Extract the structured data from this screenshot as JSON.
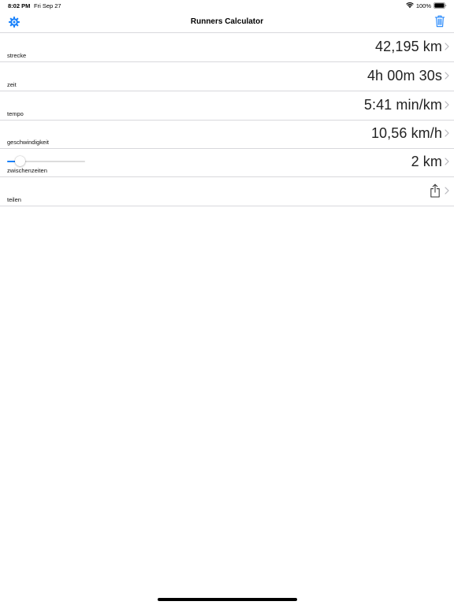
{
  "status_bar": {
    "time": "8:02 PM",
    "date": "Fri Sep 27",
    "battery": "100%",
    "icons": [
      "wifi-icon",
      "battery-icon"
    ]
  },
  "nav": {
    "title": "Runners Calculator",
    "left_icon": "gear-icon",
    "right_icon": "trash-icon"
  },
  "colors": {
    "accent": "#1a82fb",
    "separator": "#d8d8dc",
    "text": "#222222"
  },
  "rows": [
    {
      "label": "strecke",
      "value": "42,195 km"
    },
    {
      "label": "zeit",
      "value": "4h 00m 30s"
    },
    {
      "label": "tempo",
      "value": "5:41 min/km"
    },
    {
      "label": "geschwindigkeit",
      "value": "10,56 km/h"
    },
    {
      "label": "zwischenzeiten",
      "value": "2 km",
      "slider_fraction": 0.17
    },
    {
      "label": "teilen",
      "icon": "share-icon"
    }
  ]
}
